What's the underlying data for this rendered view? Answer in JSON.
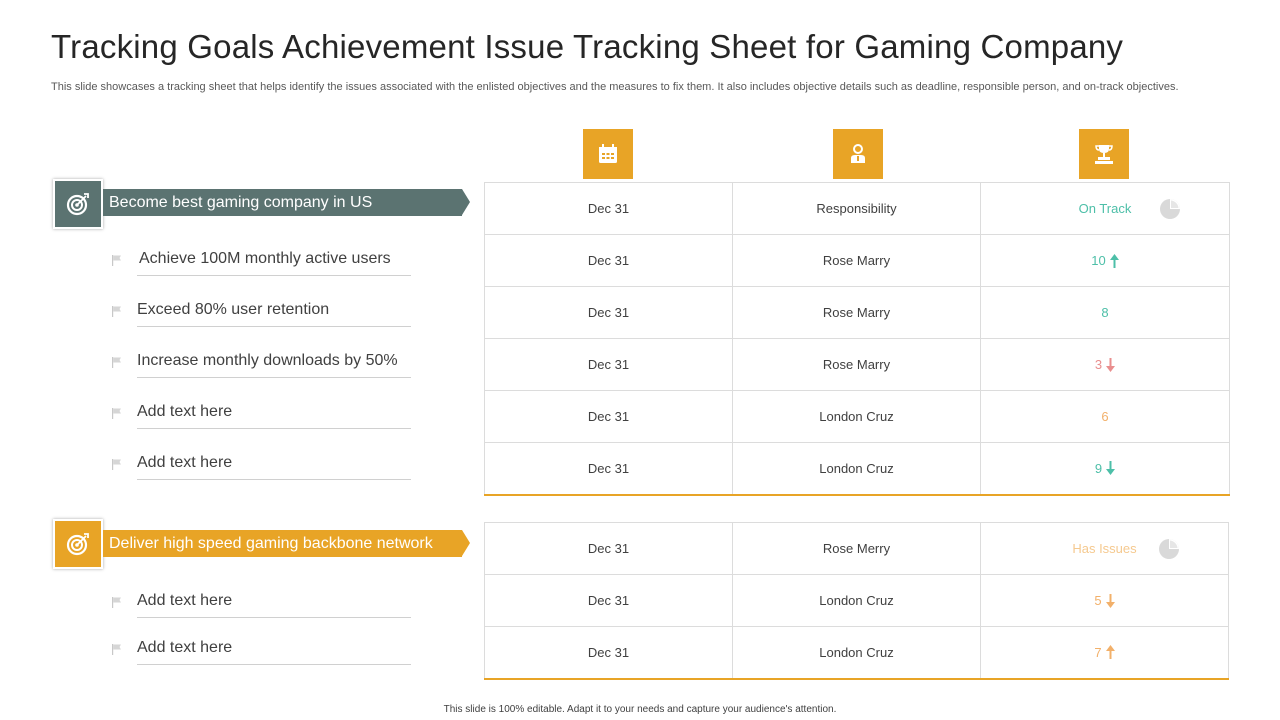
{
  "header": {
    "title": "Tracking Goals Achievement Issue Tracking Sheet for Gaming Company",
    "subtitle": "This slide showcases a tracking sheet that helps identify the issues associated with the enlisted objectives and the measures to fix them.  It also includes objective details such as deadline, responsible person, and on-track objectives."
  },
  "columns": {
    "icons": [
      "calendar-icon",
      "person-icon",
      "trophy-icon"
    ]
  },
  "colors": {
    "accent_orange": "#E8A426",
    "accent_slate": "#5B7371",
    "up_teal": "#4DBFA8",
    "down_red": "#E98E8E"
  },
  "groups": [
    {
      "banner": "Become best gaming company in US",
      "objectives": [
        "Achieve 100M monthly  active users",
        "Exceed 80% user retention",
        "Increase  monthly  downloads by 50%",
        "Add text here",
        "Add text here"
      ],
      "rows": [
        {
          "date": "Dec 31",
          "person": "Responsibility",
          "status": "On Track",
          "trend": "pie-icon"
        },
        {
          "date": "Dec 31",
          "person": "Rose Marry",
          "status": "10",
          "trend": "arrow-up"
        },
        {
          "date": "Dec 31",
          "person": "Rose Marry",
          "status": "8",
          "trend": "none"
        },
        {
          "date": "Dec 31",
          "person": "Rose Marry",
          "status": "3",
          "trend": "arrow-down"
        },
        {
          "date": "Dec 31",
          "person": "London Cruz",
          "status": "6",
          "trend": "none"
        },
        {
          "date": "Dec 31",
          "person": "London Cruz",
          "status": "9",
          "trend": "arrow-down"
        }
      ]
    },
    {
      "banner": "Deliver high speed gaming backbone network",
      "objectives": [
        "Add text here",
        "Add text here"
      ],
      "rows": [
        {
          "date": "Dec 31",
          "person": "Rose Merry",
          "status": "Has Issues",
          "trend": "pie-icon"
        },
        {
          "date": "Dec 31",
          "person": "London Cruz",
          "status": "5",
          "trend": "arrow-down"
        },
        {
          "date": "Dec 31",
          "person": "London Cruz",
          "status": "7",
          "trend": "arrow-up"
        }
      ]
    }
  ],
  "footer": "This slide is 100% editable.  Adapt it to your needs and capture your audience's attention."
}
